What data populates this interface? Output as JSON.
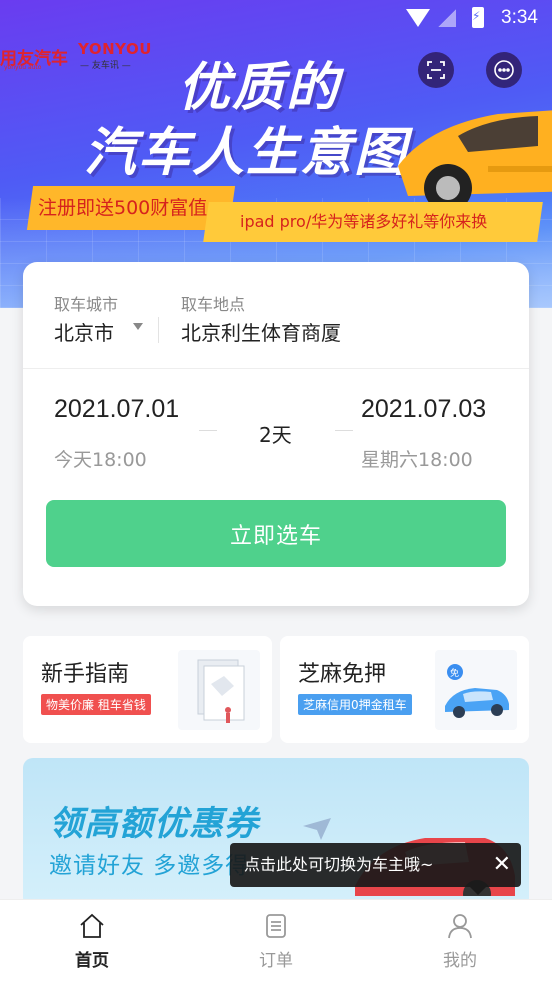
{
  "status_bar": {
    "time": "3:34"
  },
  "banner": {
    "logo_primary": "用友汽车",
    "logo_primary_sub": "yonyou auto",
    "logo_secondary": "YONYOU",
    "logo_secondary_sub": "— 友车讯 —",
    "headline_line1": "优质的",
    "headline_line2": "汽车人生意图",
    "ribbon_left": "注册即送500财富值",
    "ribbon_right": "ipad pro/华为等诸多好礼等你来换",
    "scan_icon": "scan-icon",
    "more_icon": "more-dots-icon"
  },
  "booking": {
    "city_label": "取车城市",
    "city_value": "北京市",
    "location_label": "取车地点",
    "location_value": "北京利生体育商厦",
    "pickup_date": "2021.07.01",
    "pickup_time": "今天18:00",
    "duration": "2天",
    "return_date": "2021.07.03",
    "return_time": "星期六18:00",
    "select_button": "立即选车"
  },
  "features": [
    {
      "title": "新手指南",
      "tag": "物美价廉 租车省钱",
      "tag_color": "#f0504f"
    },
    {
      "title": "芝麻免押",
      "tag": "芝麻信用0押金租车",
      "tag_color": "#4a9ff0"
    }
  ],
  "promo": {
    "title": "领高额优惠券",
    "subtitle": "邀请好友  多邀多得"
  },
  "tooltip": {
    "text": "点击此处可切换为车主哦~",
    "close": "✕"
  },
  "tabbar": {
    "items": [
      {
        "label": "首页",
        "icon": "home-icon",
        "active": true
      },
      {
        "label": "订单",
        "icon": "order-list-icon",
        "active": false
      },
      {
        "label": "我的",
        "icon": "user-icon",
        "active": false
      }
    ]
  },
  "colors": {
    "accent_green": "#4fd18c",
    "banner_purple": "#6a3cf0",
    "ribbon_yellow": "#ffb72a"
  }
}
